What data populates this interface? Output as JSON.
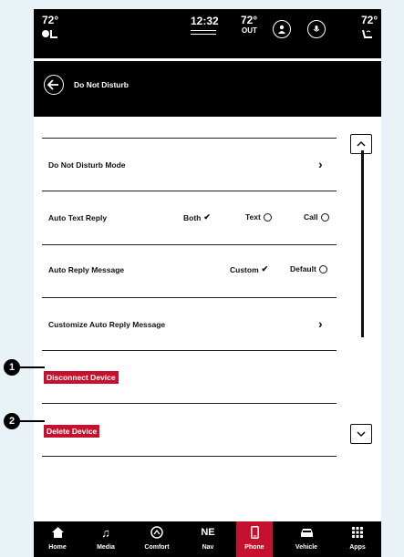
{
  "status": {
    "left_temp": "72°",
    "time": "12:32",
    "out_temp": "72°",
    "out_label": "OUT",
    "right_temp": "72°"
  },
  "header": {
    "title": "Do Not Disturb"
  },
  "settings": {
    "dnd_mode": "Do Not Disturb Mode",
    "auto_text_reply": {
      "label": "Auto Text Reply",
      "options": [
        "Both",
        "Text",
        "Call"
      ],
      "selected": "Both"
    },
    "auto_reply_message": {
      "label": "Auto Reply Message",
      "options": [
        "Custom",
        "Default"
      ],
      "selected": "Custom"
    },
    "customize": "Customize Auto Reply Message",
    "disconnect": "Disconnect Device",
    "delete": "Delete Device"
  },
  "callouts": [
    "1",
    "2"
  ],
  "nav": [
    {
      "label": "Home",
      "icon": "home-icon"
    },
    {
      "label": "Media",
      "icon": "music-note-icon"
    },
    {
      "label": "Comfort",
      "icon": "comfort-icon"
    },
    {
      "label": "Nav",
      "icon": "compass-icon",
      "glyph": "NE"
    },
    {
      "label": "Phone",
      "icon": "phone-icon",
      "active": true
    },
    {
      "label": "Vehicle",
      "icon": "car-icon"
    },
    {
      "label": "Apps",
      "icon": "apps-grid-icon"
    }
  ],
  "colors": {
    "accent": "#c5102e",
    "bar": "#000000",
    "background": "#ffffff"
  }
}
